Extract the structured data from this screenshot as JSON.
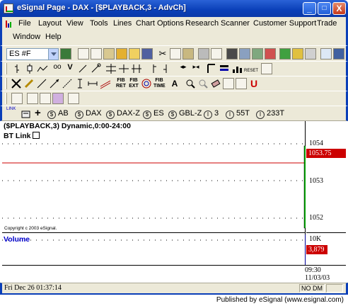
{
  "window": {
    "title": "eSignal Page - DAX - [$PLAYBACK,3 - AdvCh]",
    "minimize": "_",
    "maximize": "□",
    "close": "X"
  },
  "menu": {
    "items": [
      "File",
      "Layout",
      "View",
      "Tools",
      "Lines",
      "Chart Options",
      "Research",
      "Scanner",
      "Customer Support",
      "Trade",
      "Window",
      "Help"
    ]
  },
  "toolbar": {
    "symbol_value": "ES #F"
  },
  "link_bar": {
    "link_label": "LINK",
    "symbols": [
      "AB",
      "DAX",
      "DAX-Z",
      "ES",
      "GBL-Z",
      "3",
      "55T",
      "233T"
    ]
  },
  "chart": {
    "title": "($PLAYBACK,3) Dynamic,0:00-24:00",
    "bt_link": "BT Link",
    "copyright": "Copyright c 2003 eSignal.",
    "price_ticks": [
      "1054",
      "1053",
      "1052"
    ],
    "last_price": "1053.75",
    "volume_label": "Volume",
    "volume_tick": "10K",
    "last_volume": "3,879",
    "x_time": "09:30",
    "x_date": "11/03/03",
    "colors": {
      "up_bar": "#00aa00",
      "price_line": "#cc0000",
      "volume_line": "#0000cc",
      "tag": "#cc0000"
    }
  },
  "status": {
    "datetime": "Fri Dec 26 01:37:14",
    "mode": "NO DM"
  },
  "footer": {
    "published": "Published by eSignal (www.esignal.com)"
  }
}
